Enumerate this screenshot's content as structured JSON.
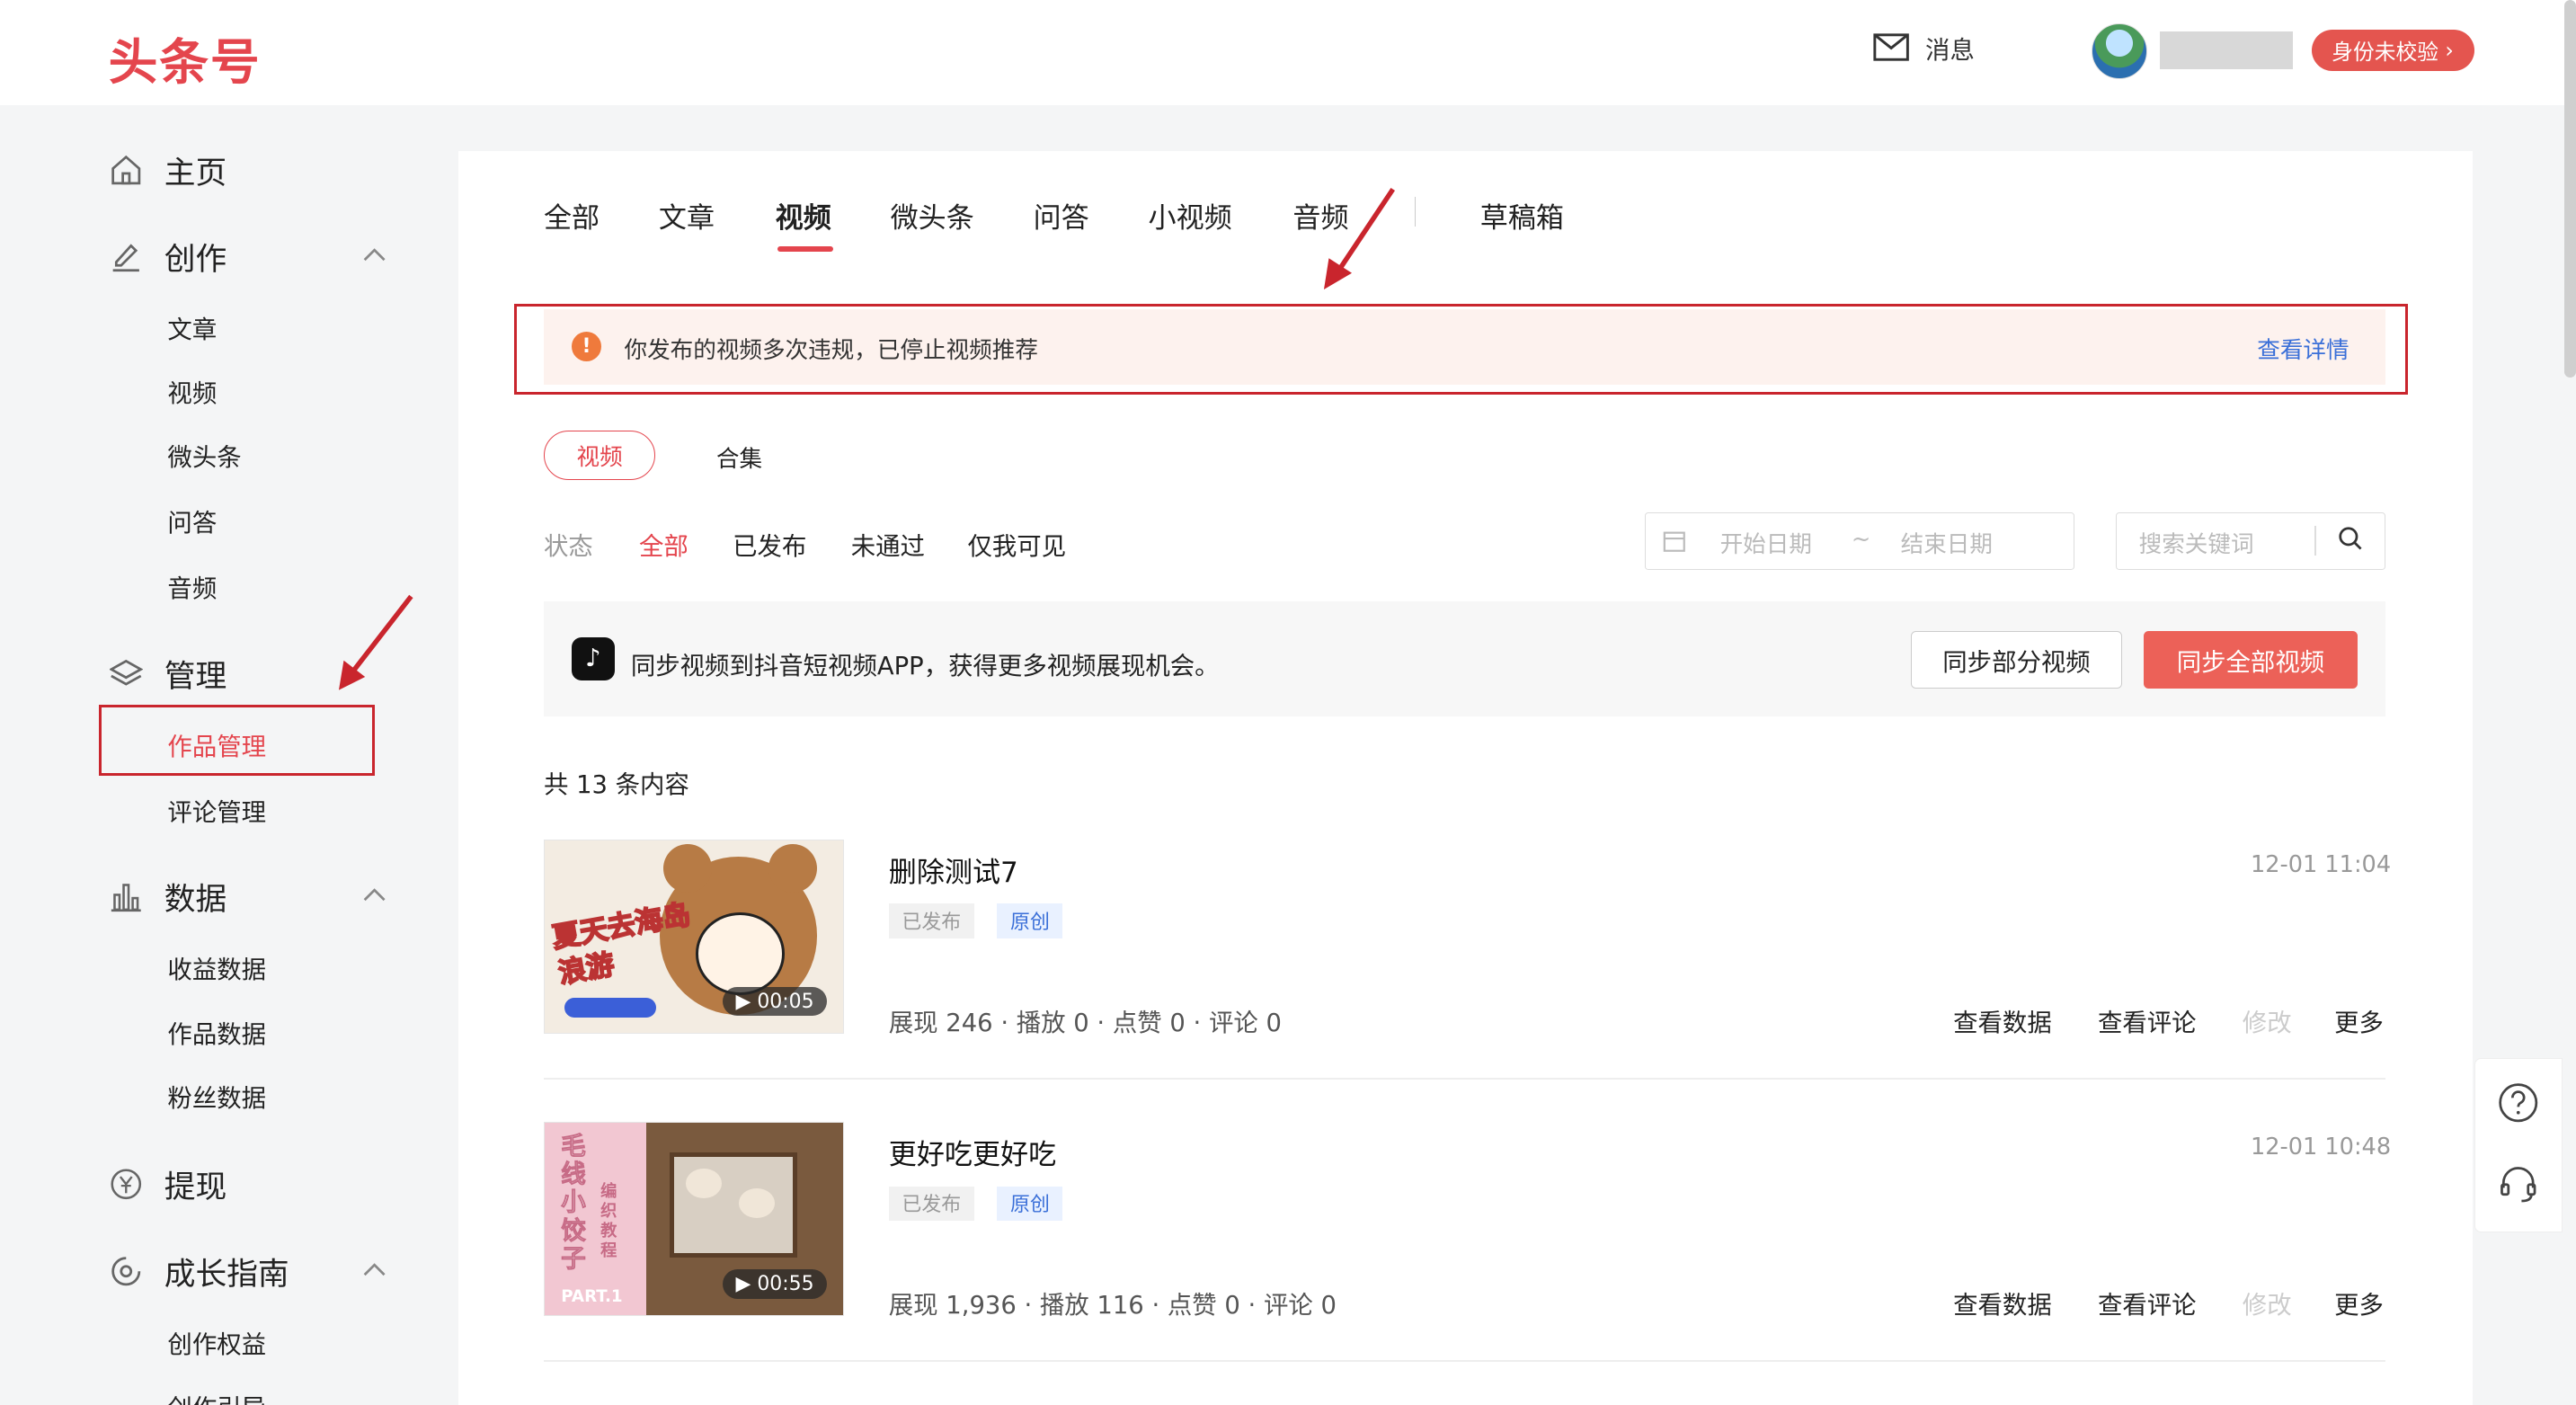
{
  "brand": {
    "logo": "头条号",
    "accent": "#e4454d"
  },
  "header": {
    "message_label": "消息",
    "verify_label": "身份未校验"
  },
  "sidebar": {
    "home": "主页",
    "create": {
      "label": "创作",
      "items": [
        "文章",
        "视频",
        "微头条",
        "问答",
        "音频"
      ]
    },
    "manage": {
      "label": "管理",
      "items": [
        "作品管理",
        "评论管理"
      ]
    },
    "data": {
      "label": "数据",
      "items": [
        "收益数据",
        "作品数据",
        "粉丝数据"
      ]
    },
    "withdraw": "提现",
    "growth": {
      "label": "成长指南",
      "items": [
        "创作权益",
        "创作引导"
      ]
    }
  },
  "tabs": [
    "全部",
    "文章",
    "视频",
    "微头条",
    "问答",
    "小视频",
    "音频",
    "草稿箱"
  ],
  "active_tab": "视频",
  "alert": {
    "text": "你发布的视频多次违规，已停止视频推荐",
    "link": "查看详情"
  },
  "subtabs": {
    "video": "视频",
    "collection": "合集"
  },
  "filters": {
    "label": "状态",
    "all": "全部",
    "published": "已发布",
    "rejected": "未通过",
    "private": "仅我可见"
  },
  "date_range": {
    "start": "开始日期",
    "sep": "~",
    "end": "结束日期"
  },
  "search": {
    "placeholder": "搜索关键词"
  },
  "sync": {
    "text": "同步视频到抖音短视频APP，获得更多视频展现机会。",
    "partial": "同步部分视频",
    "all": "同步全部视频"
  },
  "count_text": "共 13 条内容",
  "videos": [
    {
      "title": "删除测试7",
      "time": "12-01 11:04",
      "status": "已发布",
      "type": "原创",
      "duration": "00:05",
      "stats": "展现 246 · 播放 0 · 点赞 0 · 评论 0",
      "thumb_text": "夏天去海岛浪游"
    },
    {
      "title": "更好吃更好吃",
      "time": "12-01 10:48",
      "status": "已发布",
      "type": "原创",
      "duration": "00:55",
      "stats": "展现 1,936 · 播放 116 · 点赞 0 · 评论 0",
      "thumb_text": "毛线小饺子",
      "thumb_sub": "编织教程",
      "thumb_part": "PART.1"
    }
  ],
  "actions": {
    "view_data": "查看数据",
    "view_comments": "查看评论",
    "edit": "修改",
    "more": "更多"
  }
}
